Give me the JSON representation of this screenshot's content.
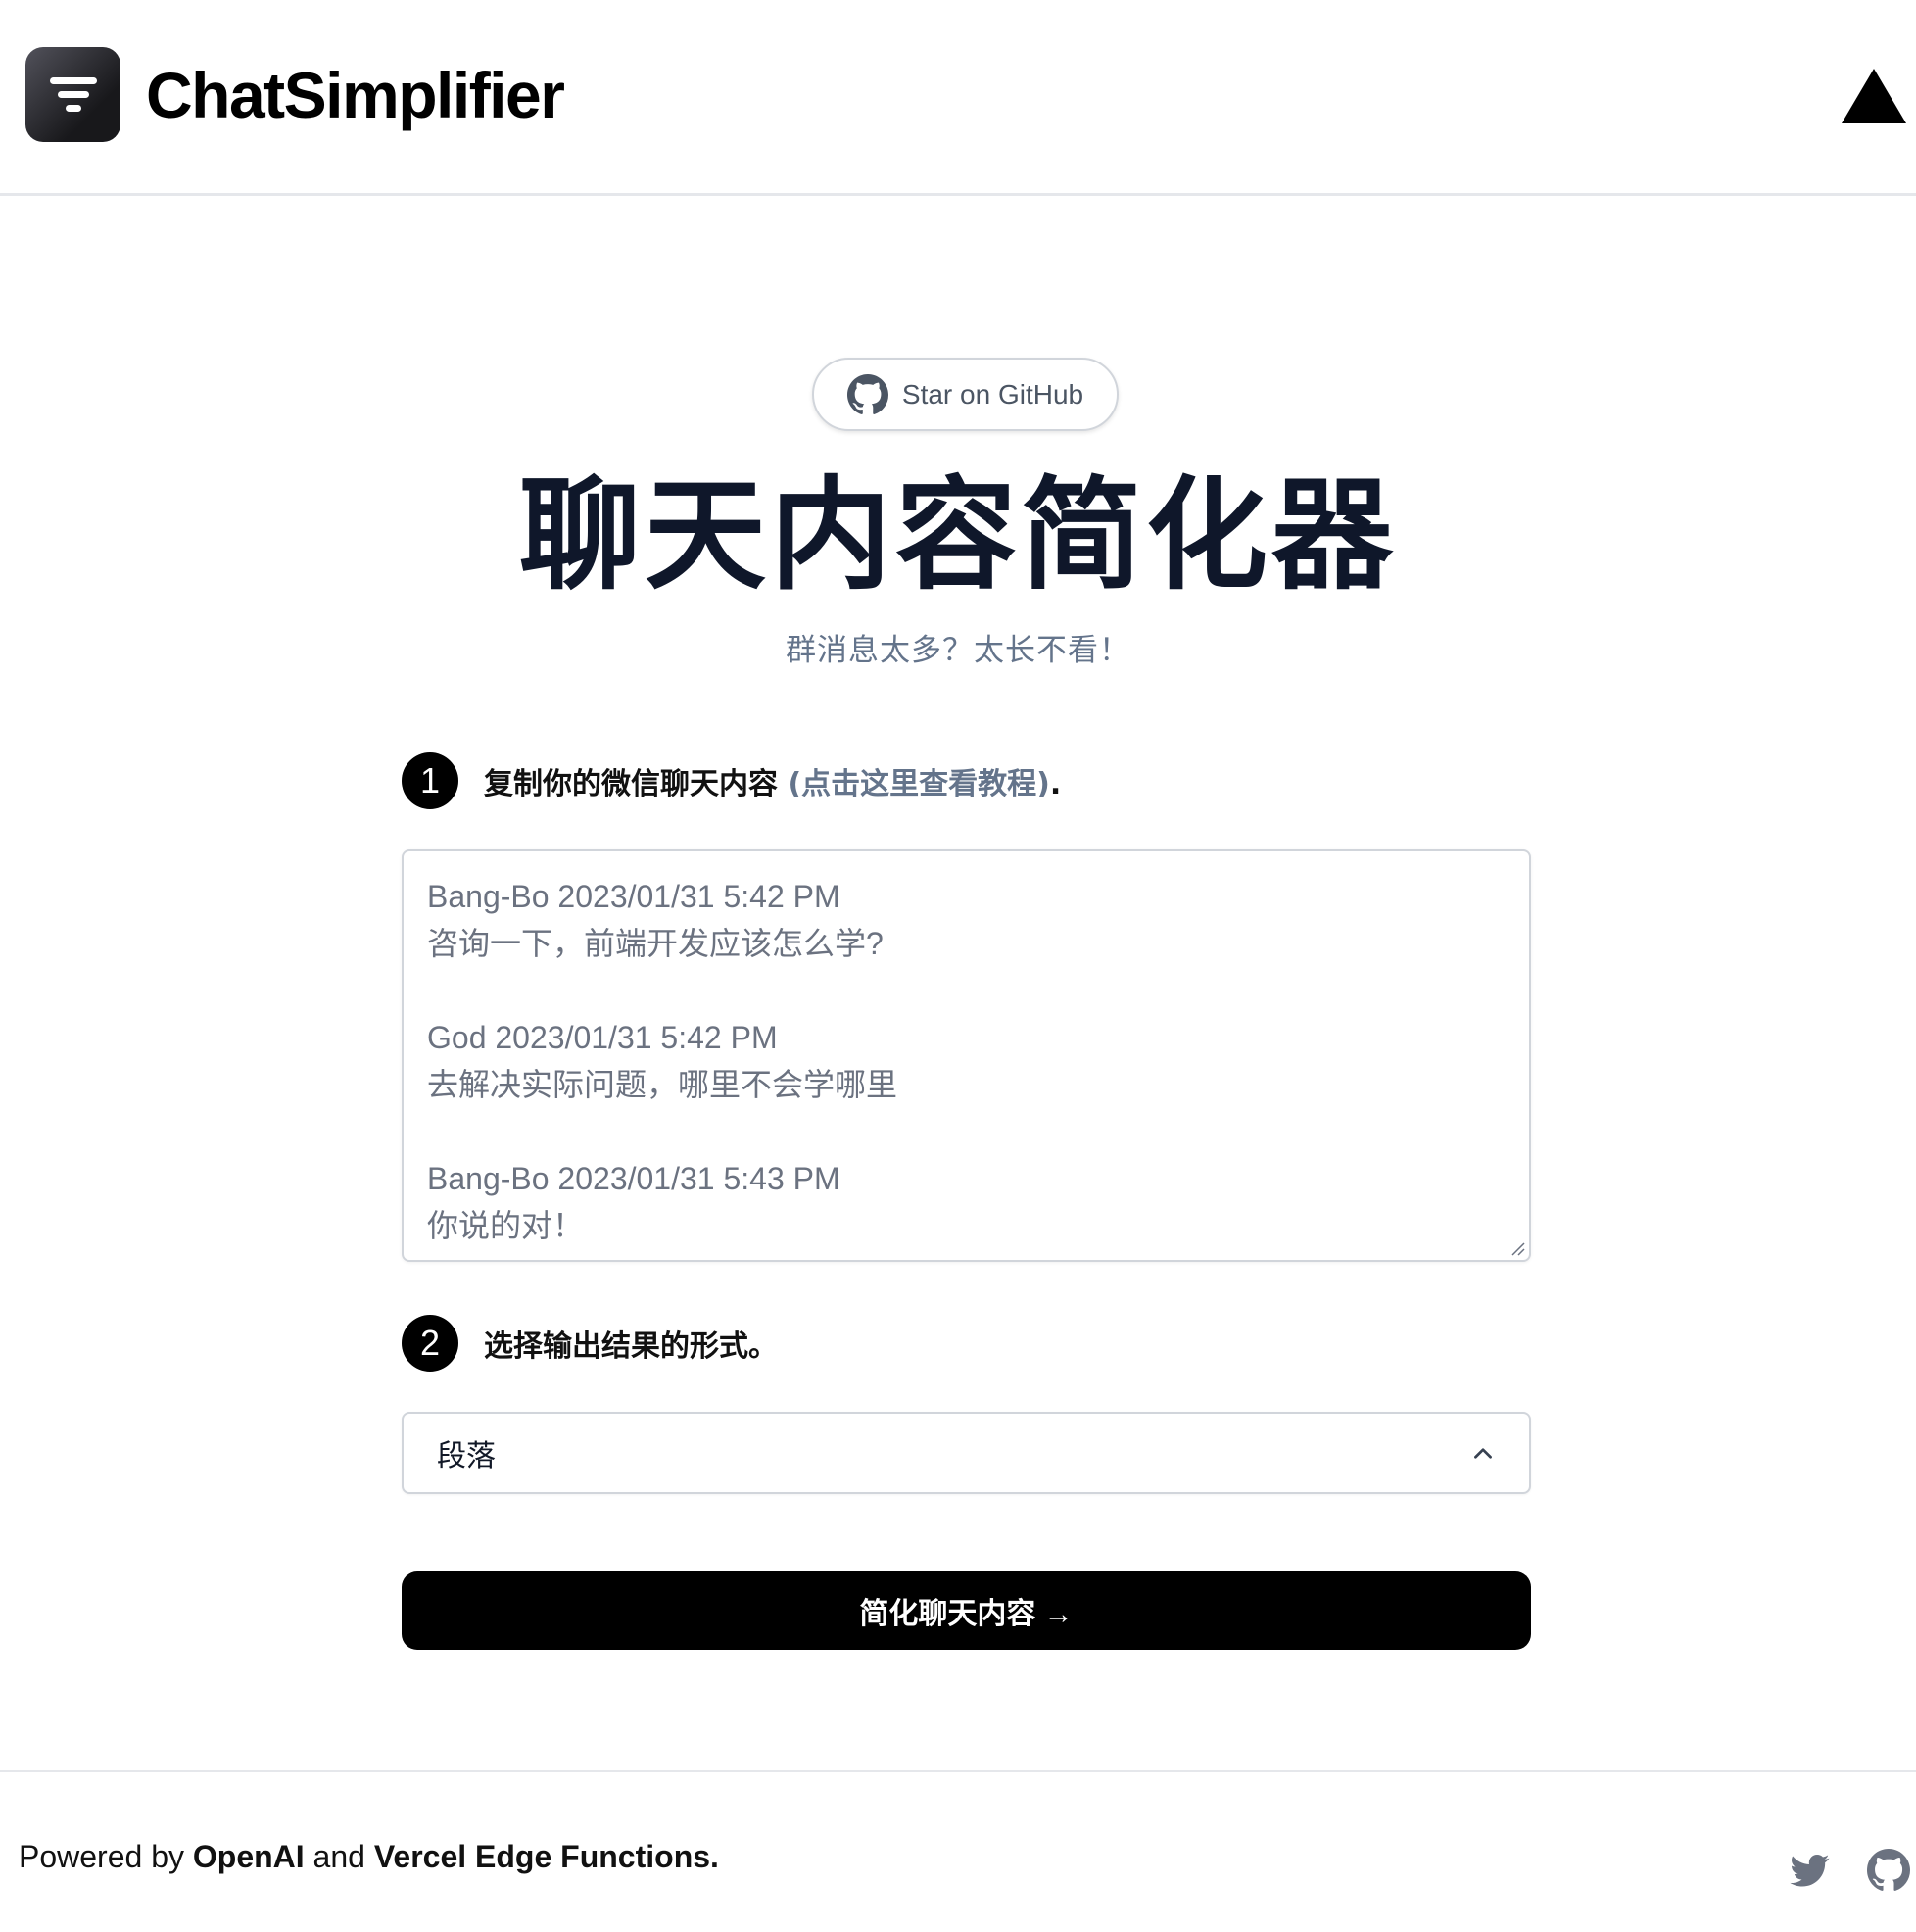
{
  "header": {
    "app_name": "ChatSimplifier",
    "logo_icon": "filter-lines-icon",
    "right_icon": "vercel-triangle-icon"
  },
  "hero": {
    "github_pill_label": "Star on GitHub",
    "github_icon": "github-icon",
    "title": "聊天内容简化器",
    "subtitle": "群消息太多？太长不看！"
  },
  "steps": {
    "step1": {
      "number": "1",
      "text": "复制你的微信聊天内容 ",
      "link": "(点击这里查看教程)",
      "suffix": "."
    },
    "step2": {
      "number": "2",
      "text": "选择输出结果的形式。"
    }
  },
  "chat_input": {
    "messages": [
      {
        "header": "Bang-Bo 2023/01/31 5:42 PM",
        "body": "咨询一下，前端开发应该怎么学?"
      },
      {
        "header": "God 2023/01/31 5:42 PM",
        "body": "去解决实际问题，哪里不会学哪里"
      },
      {
        "header": "Bang-Bo 2023/01/31 5:43 PM",
        "body": "你说的对！"
      }
    ]
  },
  "format_select": {
    "value": "段落",
    "icon": "chevron-up-icon"
  },
  "submit_button": {
    "label": "简化聊天内容 →"
  },
  "footer": {
    "powered_prefix": "Powered by ",
    "openai": "OpenAI",
    "and": " and ",
    "vercel": "Vercel Edge Functions.",
    "icons": [
      "twitter-icon",
      "github-icon"
    ]
  },
  "colors": {
    "title": "#0f172a",
    "muted": "#64748b",
    "button_bg": "#000000",
    "border": "#d1d5db"
  }
}
